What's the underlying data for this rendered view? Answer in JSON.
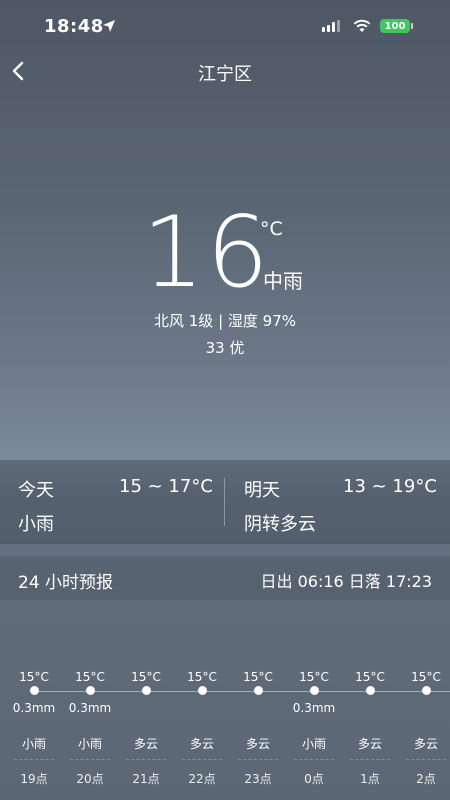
{
  "status_bar": {
    "time": "18:48",
    "battery": "100"
  },
  "nav": {
    "title": "江宁区"
  },
  "current": {
    "temperature": "16",
    "unit": "°C",
    "condition": "中雨",
    "wind_humidity": "北风 1级 | 湿度 97%",
    "aqi": "33 优"
  },
  "days": {
    "today": {
      "label": "今天",
      "range": "15 ~ 17°C",
      "condition": "小雨"
    },
    "tomorrow": {
      "label": "明天",
      "range": "13 ~ 19°C",
      "condition": "阴转多云"
    }
  },
  "forecast": {
    "title": "24 小时预报",
    "sun": "日出 06:16  日落 17:23",
    "hours": [
      {
        "temp": "15°C",
        "rain": "0.3mm",
        "cond": "小雨",
        "hour": "19点"
      },
      {
        "temp": "15°C",
        "rain": "0.3mm",
        "cond": "小雨",
        "hour": "20点"
      },
      {
        "temp": "15°C",
        "rain": "",
        "cond": "多云",
        "hour": "21点"
      },
      {
        "temp": "15°C",
        "rain": "",
        "cond": "多云",
        "hour": "22点"
      },
      {
        "temp": "15°C",
        "rain": "",
        "cond": "多云",
        "hour": "23点"
      },
      {
        "temp": "15°C",
        "rain": "0.3mm",
        "cond": "小雨",
        "hour": "0点"
      },
      {
        "temp": "15°C",
        "rain": "",
        "cond": "多云",
        "hour": "1点"
      },
      {
        "temp": "15°C",
        "rain": "",
        "cond": "多云",
        "hour": "2点"
      }
    ]
  },
  "icons": {
    "location": "location-arrow-icon",
    "signal": "cellular-signal-icon",
    "wifi": "wifi-icon",
    "battery": "battery-icon",
    "back": "chevron-left-icon"
  },
  "colors": {
    "battery": "#3cc85a"
  }
}
